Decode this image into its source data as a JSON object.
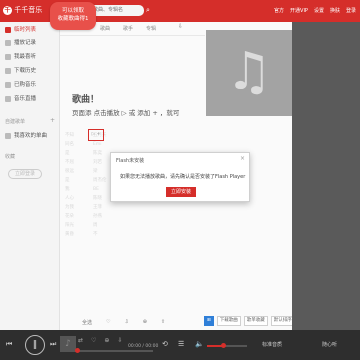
{
  "app": {
    "logo_text": "千千音乐",
    "logo_mark": "千",
    "promo_line1": "可以领取",
    "promo_line2": "收藏歌曲得1"
  },
  "search": {
    "placeholder": "歌曲、专辑名"
  },
  "top_actions": [
    "官方",
    "开通VIP",
    "设置",
    "换肤",
    "登录"
  ],
  "sidebar": {
    "items": [
      {
        "label": "临时列表",
        "active": true
      },
      {
        "label": "播放记录"
      },
      {
        "label": "我最喜听"
      },
      {
        "label": "下载历史"
      },
      {
        "label": "已购音乐"
      },
      {
        "label": "音乐直播"
      }
    ],
    "section_created": "自建歌单",
    "created_items": [
      {
        "label": "我喜欢的单曲"
      }
    ],
    "section_fav": "收藏",
    "login_label": "立即登录"
  },
  "tabs": [
    "歌曲",
    "歌手",
    "专辑"
  ],
  "empty": {
    "title": "歌曲！",
    "hint": "页面添 点击播放 ▷ 或 添加 + ，就可"
  },
  "ghost_rows": [
    {
      "c1": "不知",
      "c2": "五月天"
    },
    {
      "c1": "同名",
      "c2": "Emi"
    },
    {
      "c1": "是",
      "c2": "陈奕"
    },
    {
      "c1": "不屈",
      "c2": "刘若"
    },
    {
      "c1": "很远",
      "c2": "梁"
    },
    {
      "c1": "是",
      "c2": "周杰伦"
    },
    {
      "c1": "我",
      "c2": "BE"
    },
    {
      "c1": "人心",
      "c2": "陈晓"
    },
    {
      "c1": "为我",
      "c2": "王菲"
    },
    {
      "c1": "花朵",
      "c2": "孙燕"
    },
    {
      "c1": "阳光",
      "c2": "周"
    },
    {
      "c1": "黄昏",
      "c2": "不"
    }
  ],
  "focus_marker": "▷ +",
  "dialog": {
    "title": "Flash未安装",
    "close": "×",
    "message": "如果您无法播放歌曲，请先确认是否安装了Flash Player",
    "button": "立即安装"
  },
  "list_footer": {
    "select_all": "全选",
    "actions": [
      "♡",
      "⇩",
      "⊕",
      "⇪"
    ]
  },
  "footer_right": {
    "chip": "⊞",
    "btn1": "下载歌曲",
    "btn2": "歌单收藏",
    "btn3": "默认排序"
  },
  "player": {
    "play_icon": "‖",
    "cover_icon": "♪",
    "controls": [
      "⇄",
      "♡",
      "⊕",
      "⇩"
    ],
    "time": "00:00 / 00:00",
    "volume_percent": 40,
    "btn_quality": "标准音质",
    "btn_lyrics": "随心听"
  },
  "colors": {
    "brand_red": "#d52e2a",
    "player_bg": "#2e2e2e",
    "right_strip": "#5a5a5a",
    "album_gray": "#a3a3a3"
  }
}
